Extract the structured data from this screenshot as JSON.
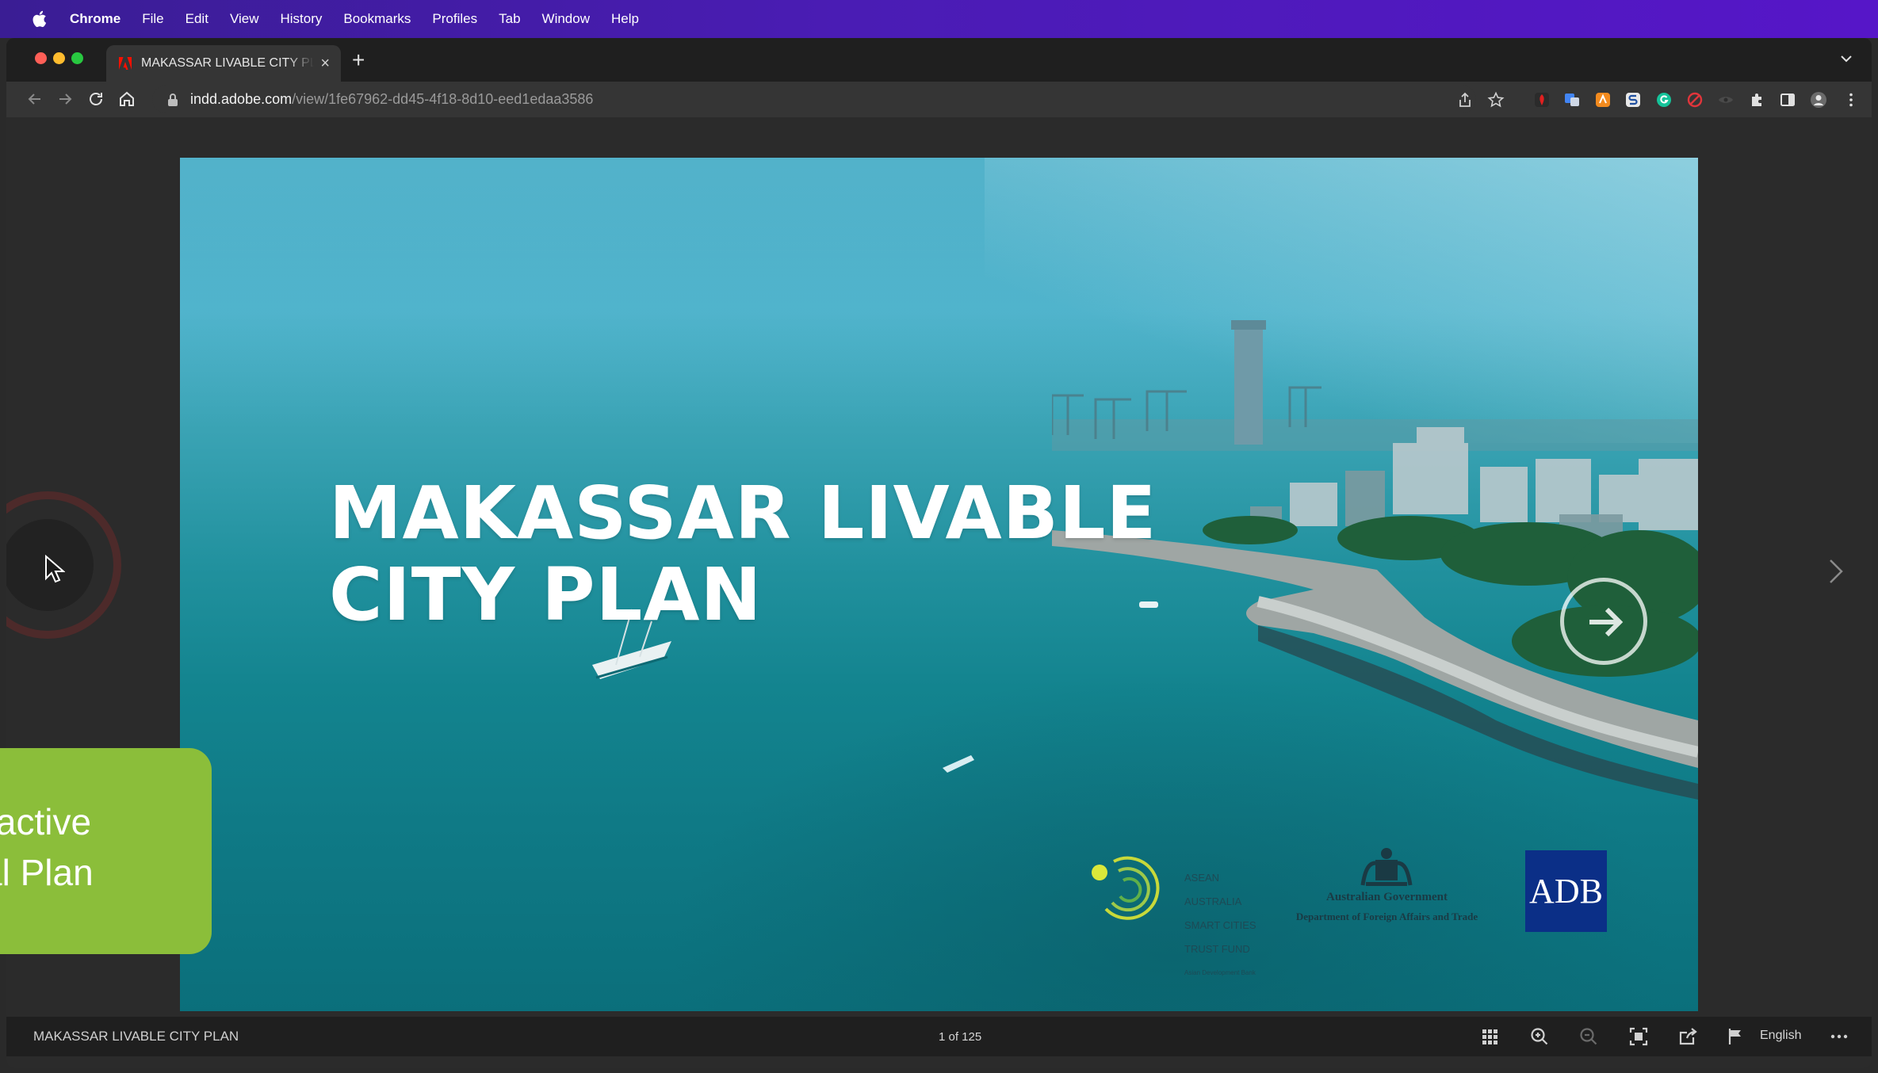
{
  "menubar": {
    "app": "Chrome",
    "items": [
      "File",
      "Edit",
      "View",
      "History",
      "Bookmarks",
      "Profiles",
      "Tab",
      "Window",
      "Help"
    ]
  },
  "tab": {
    "title": "MAKASSAR LIVABLE CITY PLAN",
    "close": "×",
    "new_tab": "+"
  },
  "address_bar": {
    "host": "indd.adobe.com",
    "path": "/view/1fe67962-dd45-4f18-8d10-eed1edaa3586"
  },
  "slide": {
    "title_line1": "MAKASSAR LIVABLE",
    "title_line2": "CITY PLAN",
    "asean_lines": [
      "ASEAN",
      "AUSTRALIA",
      "SMART CITIES",
      "TRUST FUND",
      "Asian Development Bank"
    ],
    "aus_gov": "Australian Government",
    "aus_dept": "Department of Foreign Affairs and Trade",
    "adb": "ADB"
  },
  "badge": {
    "line1": "eractive",
    "line2": "ital Plan"
  },
  "statusbar": {
    "doc_title": "MAKASSAR LIVABLE CITY PLAN",
    "page_count": "1 of 125",
    "language": "English"
  },
  "colors": {
    "menubar": "#4a1cb4",
    "badge": "#8bbe3a",
    "adb": "#0b2f87"
  }
}
